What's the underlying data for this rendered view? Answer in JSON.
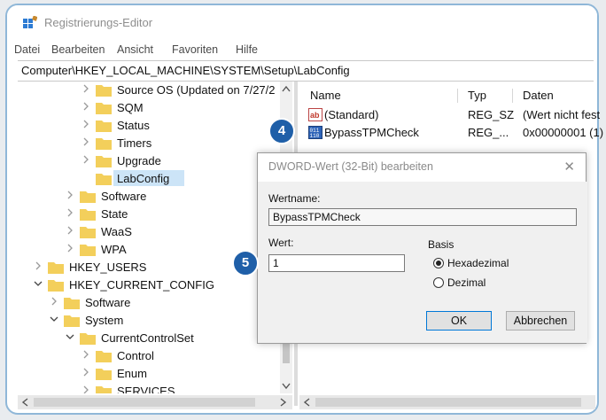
{
  "window": {
    "title": "Registrierungs-Editor"
  },
  "menu": [
    "Datei",
    "Bearbeiten",
    "Ansicht",
    "Favoriten",
    "Hilfe"
  ],
  "address": "Computer\\HKEY_LOCAL_MACHINE\\SYSTEM\\Setup\\LabConfig",
  "tree": {
    "items": [
      {
        "label": "Source OS (Updated on 7/27/2"
      },
      {
        "label": "SQM"
      },
      {
        "label": "Status"
      },
      {
        "label": "Timers"
      },
      {
        "label": "Upgrade"
      },
      {
        "label": "LabConfig",
        "selected": true
      },
      {
        "label": "Software"
      },
      {
        "label": "State"
      },
      {
        "label": "WaaS"
      },
      {
        "label": "WPA"
      },
      {
        "label": "HKEY_USERS"
      },
      {
        "label": "HKEY_CURRENT_CONFIG"
      },
      {
        "label": "Software"
      },
      {
        "label": "System"
      },
      {
        "label": "CurrentControlSet"
      },
      {
        "label": "Control"
      },
      {
        "label": "Enum"
      },
      {
        "label": "SERVICES"
      }
    ]
  },
  "list": {
    "columns": [
      "Name",
      "Typ",
      "Daten"
    ],
    "rows": [
      {
        "name": "(Standard)",
        "type": "REG_SZ",
        "data": "(Wert nicht fest",
        "icon": "string-value-icon"
      },
      {
        "name": "BypassTPMCheck",
        "type": "REG_...",
        "data": "0x00000001 (1)",
        "icon": "dword-value-icon"
      }
    ]
  },
  "dialog": {
    "title": "DWORD-Wert (32-Bit) bearbeiten",
    "name_label": "Wertname:",
    "name_value": "BypassTPMCheck",
    "value_label": "Wert:",
    "value_value": "1",
    "base_label": "Basis",
    "hex_label": "Hexadezimal",
    "dec_label": "Dezimal",
    "base_selected": "Hexadezimal",
    "ok_label": "OK",
    "cancel_label": "Abbrechen"
  },
  "badges": {
    "step4": "4",
    "step5": "5"
  },
  "colors": {
    "badge": "#1f5fa8",
    "folder": "#f3cf5b",
    "selection": "#cce4f7",
    "frame": "#8fb7d8"
  }
}
